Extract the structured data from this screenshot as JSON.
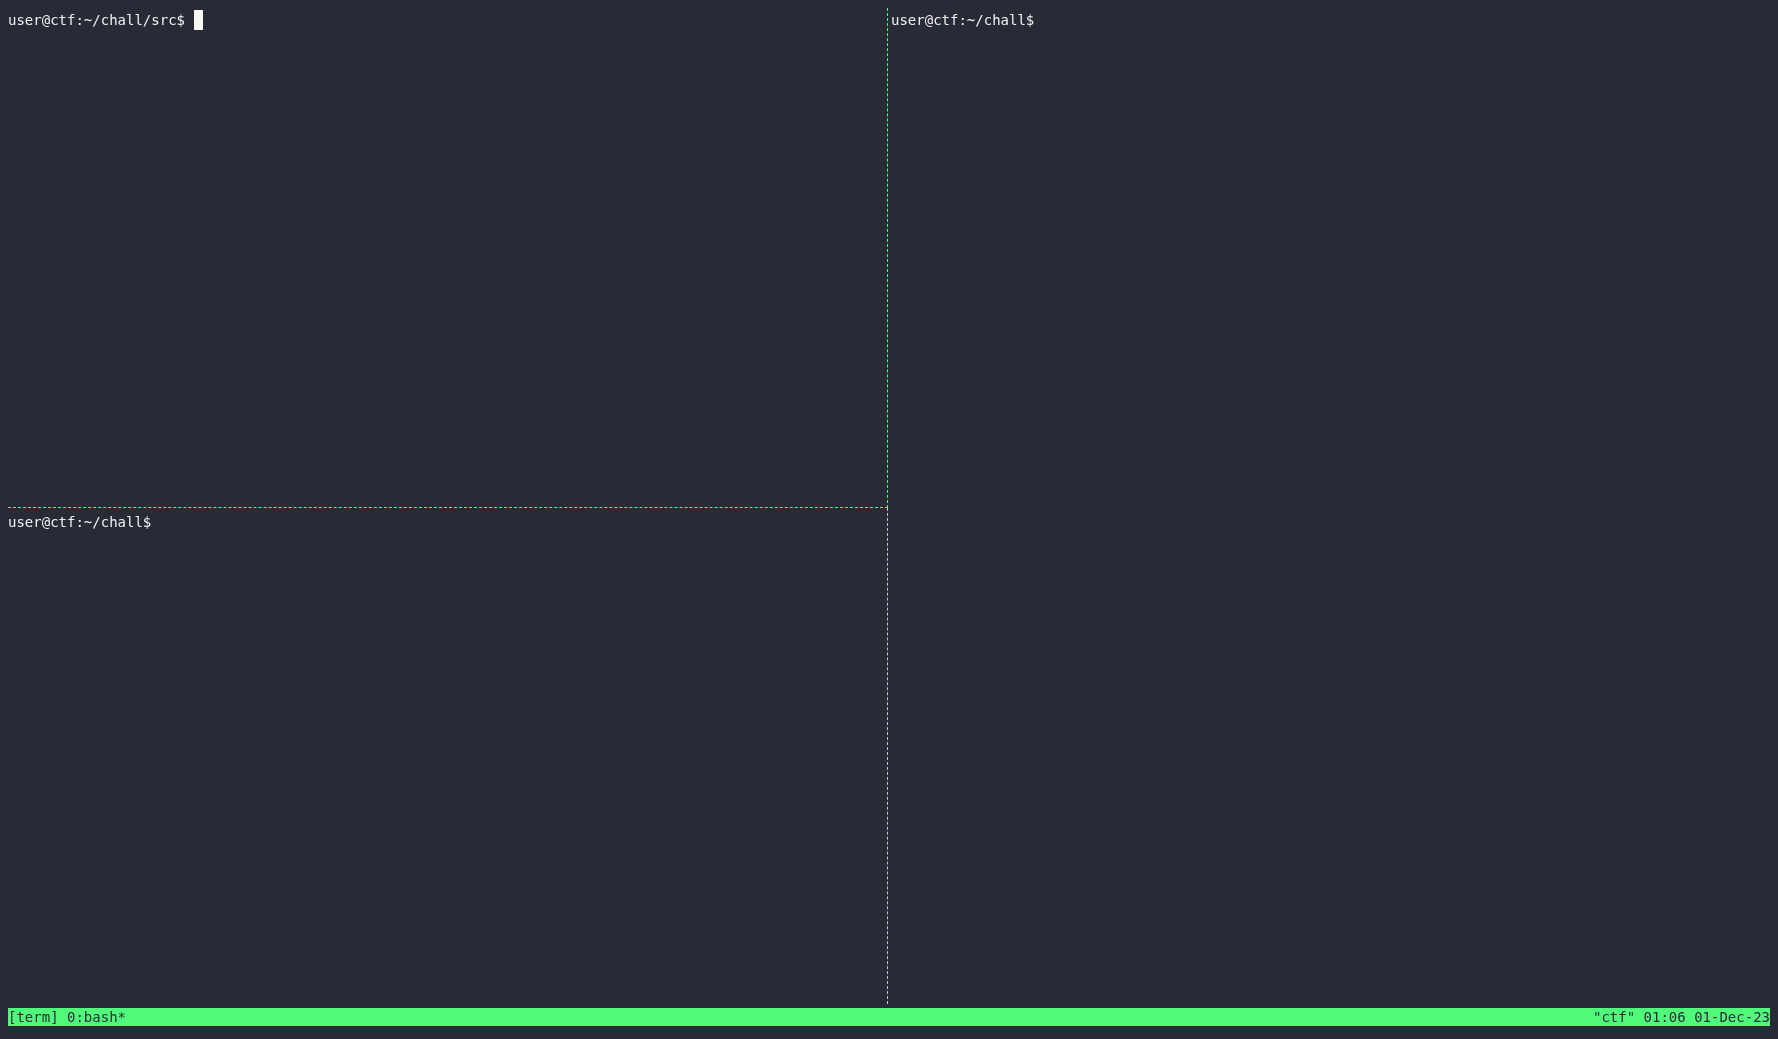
{
  "panes": [
    {
      "prompt": "user@ctf:~/chall/src$",
      "active": true,
      "cursor": true
    },
    {
      "prompt": "user@ctf:~/chall$",
      "active": false,
      "cursor": false
    },
    {
      "prompt": "user@ctf:~/chall$",
      "active": false,
      "cursor": false
    }
  ],
  "status_bar": {
    "left": "[term] 0:bash*",
    "right": "\"ctf\" 01:06 01-Dec-23"
  }
}
